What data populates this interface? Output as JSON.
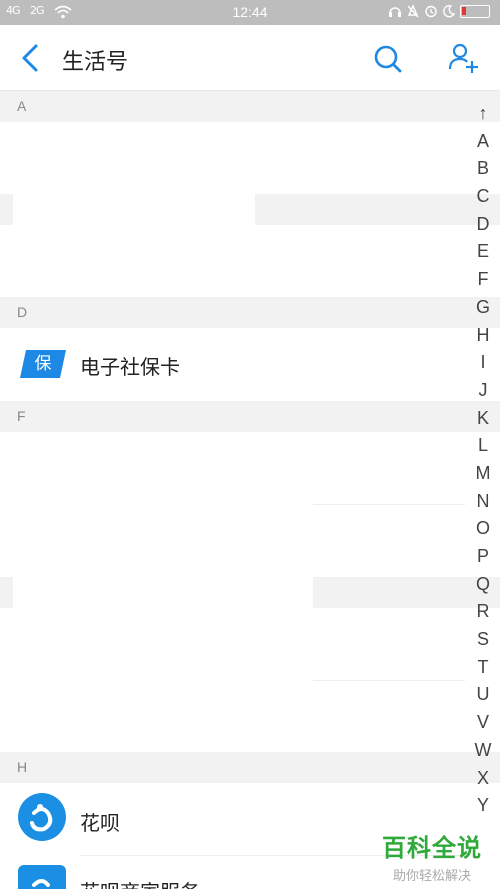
{
  "status": {
    "signal1": "4G",
    "signal2": "2G",
    "time": "12:44"
  },
  "header": {
    "title": "生活号"
  },
  "sections": {
    "a": "A",
    "d": "D",
    "f": "F",
    "h": "H"
  },
  "items": {
    "shebao": {
      "label": "电子社保卡",
      "icon_text": "保"
    },
    "huabei": {
      "label": "花呗"
    },
    "huabei2": {
      "label": "花呗商家服务"
    }
  },
  "index": [
    "↑",
    "A",
    "B",
    "C",
    "D",
    "E",
    "F",
    "G",
    "H",
    "I",
    "J",
    "K",
    "L",
    "M",
    "N",
    "O",
    "P",
    "Q",
    "R",
    "S",
    "T",
    "U",
    "V",
    "W",
    "X",
    "Y"
  ],
  "watermark": {
    "title": "百科全说",
    "subtitle": "助你轻松解决"
  },
  "colors": {
    "accent": "#1e88e5",
    "shebao_blue": "#1e88e5",
    "huabei_blue": "#1a8fe3",
    "watermark_green": "#2fa93a",
    "battery_red": "#e53935"
  }
}
